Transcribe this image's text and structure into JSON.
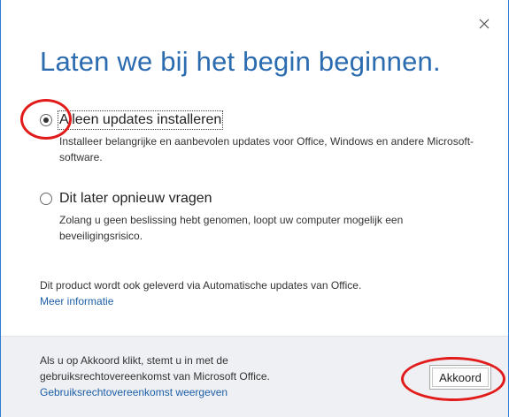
{
  "dialog": {
    "title": "Laten we bij het begin beginnen.",
    "close_icon": "close-icon"
  },
  "options": [
    {
      "label": "Alleen updates installeren",
      "description": "Installeer belangrijke en aanbevolen updates voor Office, Windows en andere Microsoft-software.",
      "checked": true
    },
    {
      "label": "Dit later opnieuw vragen",
      "description": "Zolang u geen beslissing hebt genomen, loopt uw computer mogelijk een beveiligingsrisico.",
      "checked": false
    }
  ],
  "note": {
    "text": "Dit product wordt ook geleverd via Automatische updates van Office.",
    "link": "Meer informatie"
  },
  "footer": {
    "text": "Als u op Akkoord klikt, stemt u in met de gebruiksrechtovereenkomst van Microsoft Office.",
    "link": "Gebruiksrechtovereenkomst weergeven",
    "accept_label": "Akkoord"
  },
  "colors": {
    "title": "#2b6cb0",
    "link": "#1d5fa8",
    "annotation": "#e21b1b",
    "footer_bg": "#eef0f3"
  }
}
